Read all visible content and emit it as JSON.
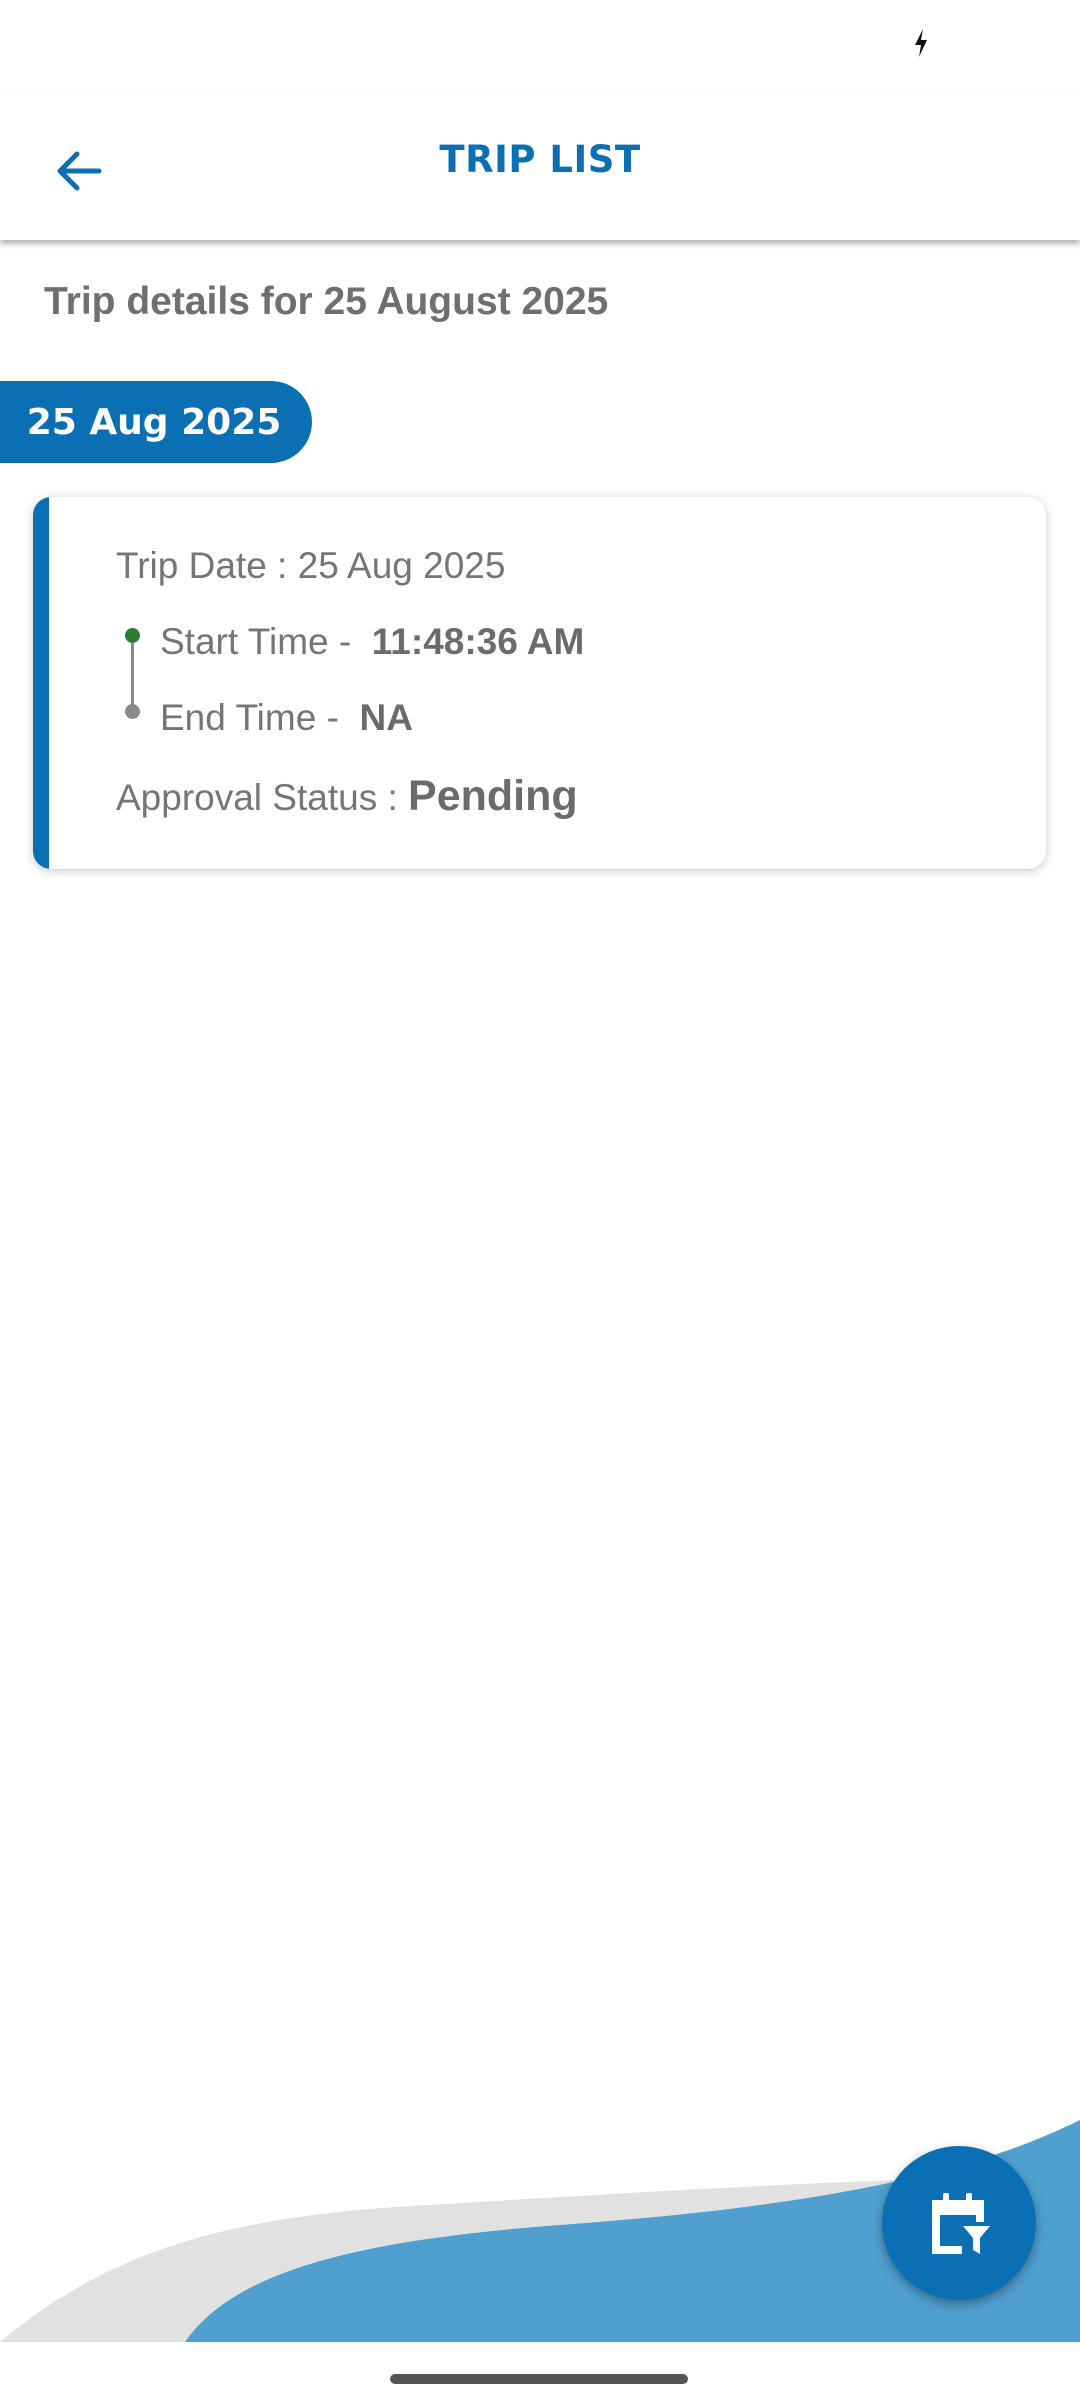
{
  "app_bar": {
    "title": "TRIP LIST"
  },
  "subtitle": "Trip details for 25 August 2025",
  "date_pill": "25 Aug 2025",
  "trip_card": {
    "trip_date_label": "Trip Date : 25 Aug 2025",
    "start_time_label": "Start Time -",
    "start_time_value": "11:48:36 AM",
    "end_time_label": "End Time -",
    "end_time_value": "NA",
    "approval_label": "Approval Status :",
    "approval_value": "Pending"
  },
  "icons": {
    "back": "arrow-back-icon",
    "status": "charging-icon",
    "fab": "calendar-filter-icon"
  },
  "colors": {
    "primary": "#0b6fb3",
    "start_dot": "#2e7d32",
    "wave_light": "#4f9fcf",
    "wave_grey": "#e1e1e1"
  }
}
